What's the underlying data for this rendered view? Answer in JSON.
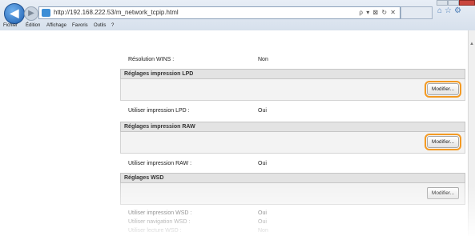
{
  "browser": {
    "url": "http://192.168.222.53/m_network_tcpip.html",
    "address_tools": "ρ ▾ ⊠ ↻ ✕",
    "icons": [
      "back-icon",
      "forward-icon",
      "home-icon",
      "star-icon",
      "gear-icon"
    ]
  },
  "menubar": {
    "items": [
      "Fichier",
      "Édition",
      "Affichage",
      "Favoris",
      "Outils",
      "?"
    ]
  },
  "content": {
    "wins_row": {
      "label": "Résolution WINS :",
      "value": "Non"
    },
    "sections": [
      {
        "title": "Réglages impression LPD",
        "button": "Modifier...",
        "label": "Utiliser impression LPD :",
        "value": "Oui"
      },
      {
        "title": "Réglages impression RAW",
        "button": "Modifier...",
        "label": "Utiliser impression RAW :",
        "value": "Oui"
      },
      {
        "title": "Réglages WSD",
        "button": "Modifier...",
        "rows": [
          {
            "label": "Utiliser impression WSD :",
            "value": "Oui"
          },
          {
            "label": "Utiliser navigation WSD :",
            "value": "Oui"
          },
          {
            "label": "Utiliser lecture WSD :",
            "value": "Non"
          }
        ]
      }
    ]
  },
  "colors": {
    "highlight": "#f39a23",
    "section_header": "#e3e3e3"
  }
}
